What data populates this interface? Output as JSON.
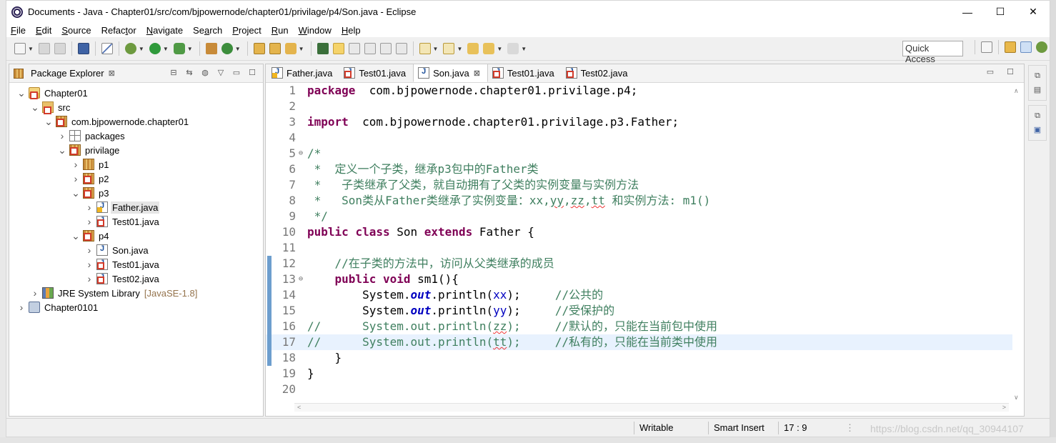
{
  "window": {
    "title": "Documents - Java - Chapter01/src/com/bjpowernode/chapter01/privilage/p4/Son.java - Eclipse",
    "controls": [
      "—",
      "☐",
      "✕"
    ]
  },
  "menu": [
    {
      "u": "F",
      "rest": "ile"
    },
    {
      "u": "E",
      "rest": "dit"
    },
    {
      "u": "S",
      "rest": "ource"
    },
    {
      "pre": "Refac",
      "u": "t",
      "rest": "or"
    },
    {
      "u": "N",
      "rest": "avigate"
    },
    {
      "pre": "Se",
      "u": "a",
      "rest": "rch"
    },
    {
      "u": "P",
      "rest": "roject"
    },
    {
      "u": "R",
      "rest": "un"
    },
    {
      "u": "W",
      "rest": "indow"
    },
    {
      "u": "H",
      "rest": "elp"
    }
  ],
  "toolbar": {
    "quick_access": "Quick Access"
  },
  "package_explorer": {
    "title": "Package Explorer",
    "close": "⊠",
    "tree": [
      {
        "label": "Chapter01",
        "depth": 0,
        "twisty": "v",
        "icon": "project"
      },
      {
        "label": "src",
        "depth": 1,
        "twisty": "v",
        "icon": "src"
      },
      {
        "label": "com.bjpowernode.chapter01",
        "depth": 2,
        "twisty": "v",
        "icon": "pkg-err"
      },
      {
        "label": "packages",
        "depth": 3,
        "twisty": ">",
        "icon": "pkg-plain"
      },
      {
        "label": "privilage",
        "depth": 3,
        "twisty": "v",
        "icon": "pkg-err"
      },
      {
        "label": "p1",
        "depth": 4,
        "twisty": ">",
        "icon": "pkg"
      },
      {
        "label": "p2",
        "depth": 4,
        "twisty": ">",
        "icon": "pkg-err"
      },
      {
        "label": "p3",
        "depth": 4,
        "twisty": "v",
        "icon": "pkg-err"
      },
      {
        "label": "Father.java",
        "depth": 5,
        "twisty": ">",
        "icon": "java-warn",
        "selected": true
      },
      {
        "label": "Test01.java",
        "depth": 5,
        "twisty": ">",
        "icon": "java-err"
      },
      {
        "label": "p4",
        "depth": 4,
        "twisty": "v",
        "icon": "pkg-err"
      },
      {
        "label": "Son.java",
        "depth": 5,
        "twisty": ">",
        "icon": "java"
      },
      {
        "label": "Test01.java",
        "depth": 5,
        "twisty": ">",
        "icon": "java-err"
      },
      {
        "label": "Test02.java",
        "depth": 5,
        "twisty": ">",
        "icon": "java-err"
      },
      {
        "label": "JRE System Library",
        "decor": "[JavaSE-1.8]",
        "depth": 1,
        "twisty": ">",
        "icon": "lib"
      },
      {
        "label": "Chapter0101",
        "depth": 0,
        "twisty": ">",
        "icon": "folder"
      }
    ]
  },
  "editor": {
    "tabs": [
      {
        "label": "Father.java",
        "icon": "java-warn",
        "active": false
      },
      {
        "label": "Test01.java",
        "icon": "java-err",
        "active": false
      },
      {
        "label": "Son.java",
        "icon": "java",
        "active": true,
        "close": "⊠"
      },
      {
        "label": "Test01.java",
        "icon": "java-err",
        "active": false
      },
      {
        "label": "Test02.java",
        "icon": "java-err",
        "active": false
      }
    ],
    "lines": [
      {
        "n": "1",
        "segs": [
          [
            "kw",
            "package"
          ],
          [
            "",
            "  com.bjpowernode.chapter01.privilage.p4;"
          ]
        ]
      },
      {
        "n": "2",
        "segs": []
      },
      {
        "n": "3",
        "segs": [
          [
            "kw",
            "import"
          ],
          [
            "",
            "  com.bjpowernode.chapter01.privilage.p3.Father;"
          ]
        ]
      },
      {
        "n": "4",
        "segs": []
      },
      {
        "n": "5",
        "fold": "⊖",
        "segs": [
          [
            "cm",
            "/*"
          ]
        ]
      },
      {
        "n": "6",
        "segs": [
          [
            "cm",
            " *  定义一个子类，继承p3包中的Father类"
          ]
        ]
      },
      {
        "n": "7",
        "segs": [
          [
            "cm",
            " *   子类继承了父类，就自动拥有了父类的实例变量与实例方法"
          ]
        ]
      },
      {
        "n": "8",
        "segs": [
          [
            "cm",
            " *   Son类从Father类继承了实例变量：xx,"
          ],
          [
            "cm squig",
            "yy"
          ],
          [
            "cm",
            ","
          ],
          [
            "cm squig",
            "zz"
          ],
          [
            "cm",
            ","
          ],
          [
            "cm squig",
            "tt"
          ],
          [
            "cm",
            " 和实例方法: m1()"
          ]
        ]
      },
      {
        "n": "9",
        "segs": [
          [
            "cm",
            " */"
          ]
        ]
      },
      {
        "n": "10",
        "segs": [
          [
            "kw",
            "public"
          ],
          [
            "",
            " "
          ],
          [
            "kw",
            "class"
          ],
          [
            "",
            " Son "
          ],
          [
            "kw",
            "extends"
          ],
          [
            "",
            " Father {"
          ]
        ]
      },
      {
        "n": "11",
        "segs": []
      },
      {
        "n": "12",
        "mark": true,
        "segs": [
          [
            "cm",
            "    //在子类的方法中，访问从父类继承的成员"
          ]
        ]
      },
      {
        "n": "13",
        "mark": true,
        "fold": "⊖",
        "segs": [
          [
            "",
            "    "
          ],
          [
            "kw",
            "public"
          ],
          [
            "",
            " "
          ],
          [
            "kw",
            "void"
          ],
          [
            "",
            " sm1(){"
          ]
        ]
      },
      {
        "n": "14",
        "mark": true,
        "segs": [
          [
            "",
            "        System."
          ],
          [
            "sfld",
            "out"
          ],
          [
            "",
            ".println("
          ],
          [
            "fld",
            "xx"
          ],
          [
            "",
            ");     "
          ],
          [
            "cm",
            "//公共的"
          ]
        ]
      },
      {
        "n": "15",
        "mark": true,
        "segs": [
          [
            "",
            "        System."
          ],
          [
            "sfld",
            "out"
          ],
          [
            "",
            ".println("
          ],
          [
            "fld",
            "yy"
          ],
          [
            "",
            ");     "
          ],
          [
            "cm",
            "//受保护的"
          ]
        ]
      },
      {
        "n": "16",
        "mark": true,
        "segs": [
          [
            "cm",
            "//      System.out.println("
          ],
          [
            "cm squig",
            "zz"
          ],
          [
            "cm",
            ");     //默认的，只能在当前包中使用"
          ]
        ]
      },
      {
        "n": "17",
        "mark": true,
        "current": true,
        "segs": [
          [
            "cm",
            "//      System.out.println("
          ],
          [
            "cm squig",
            "tt"
          ],
          [
            "cm",
            ");     //私有的，只能在当前类中使用"
          ]
        ]
      },
      {
        "n": "18",
        "mark": true,
        "segs": [
          [
            "",
            "    }"
          ]
        ]
      },
      {
        "n": "19",
        "segs": [
          [
            "",
            "}"
          ]
        ]
      },
      {
        "n": "20",
        "segs": []
      }
    ]
  },
  "statusbar": {
    "writable": "Writable",
    "insert_mode": "Smart Insert",
    "position": "17 : 9"
  },
  "watermark": "https://blog.csdn.net/qq_30944107",
  "colors": {
    "keyword": "#7f0055",
    "comment": "#3f7f5f",
    "field": "#0000c0",
    "current_line": "#e8f2fe"
  }
}
